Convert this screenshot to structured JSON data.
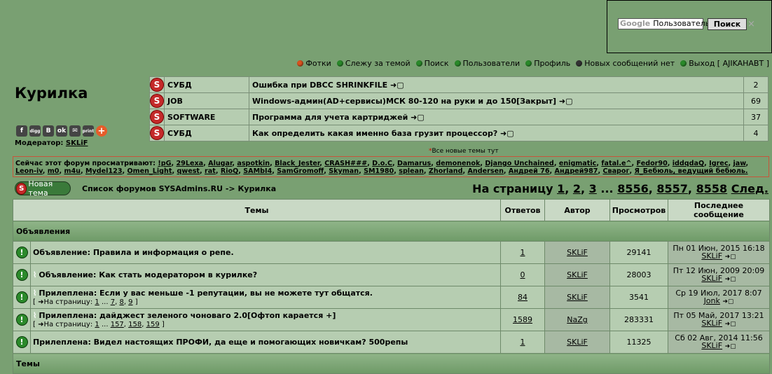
{
  "google": {
    "logo": "Google",
    "placeholder": "Пользователь",
    "button": "Поиск",
    "close": "×"
  },
  "nav": [
    {
      "label": "Фотки",
      "color": "#d9531f"
    },
    {
      "label": "Слежу за темой",
      "color": "#2a8a2a"
    },
    {
      "label": "Поиск",
      "color": "#2a8a2a"
    },
    {
      "label": "Пользователи",
      "color": "#2a8a2a"
    },
    {
      "label": "Профиль",
      "color": "#2a8a2a"
    },
    {
      "label": "Новых сообщений нет",
      "color": "#333333"
    },
    {
      "label": "Выход [ AJIKAHABT ]",
      "color": "#2a8a2a"
    }
  ],
  "forum_title": "Курилка",
  "share_icons": [
    "f",
    "digg",
    "B",
    "ok",
    "✉",
    "print",
    "+"
  ],
  "moderator": {
    "label": "Модератор:",
    "name": "SKLiF"
  },
  "hot_topics": [
    {
      "cat": "СУБД",
      "title": "Ошибка при DBCC SHRINKFILE ➜▢",
      "count": "2"
    },
    {
      "cat": "JOB",
      "title": "Windows-админ(AD+сервисы)МСК 80-120 на руки и до 150[Закрыт] ➜▢",
      "count": "69"
    },
    {
      "cat": "SOFTWARE",
      "title": "Программа для учета картриджей ➜▢",
      "count": "37"
    },
    {
      "cat": "СУБД",
      "title": "Как определить какая именно база грузит процессор? ➜▢",
      "count": "4"
    }
  ],
  "all_new": "Все новые темы тут",
  "viewers": {
    "label": "Сейчас этот форум просматривают:",
    "users": [
      "!pG",
      "29Lexa",
      "Alugar",
      "aspotkin",
      "Black_Jester",
      "CRASH###",
      "D.o.C",
      "Damarus",
      "demonenok",
      "Django Unchained",
      "enigmatic",
      "fatal.e^",
      "Fedor90",
      "iddqdaQ",
      "Igrec",
      "jaw",
      "Leon-iv",
      "m0",
      "m4u",
      "Mydel123",
      "Omen_Light",
      "qwest",
      "rat",
      "RioQ",
      "SAMbI4",
      "SamGromoff",
      "Skyman",
      "SM1980",
      "splean",
      "Zhorland",
      "Andersen",
      "Андрей 76",
      "Андрей987",
      "Сварог",
      "Я_Бебюль, ведущий бебюль."
    ]
  },
  "new_topic": "Новая тема",
  "breadcrumb": "Список форумов SYSAdmins.RU -> Курилка",
  "pager": {
    "label": "На страницу",
    "pages": [
      "1",
      "2",
      "3",
      "...",
      "8556",
      "8557",
      "8558"
    ],
    "next": "След."
  },
  "columns": {
    "topics": "Темы",
    "replies": "Ответов",
    "author": "Автор",
    "views": "Просмотров",
    "last": "Последнее сообщение"
  },
  "section1": "Объявления",
  "section2": "Темы",
  "topics": [
    {
      "clip": false,
      "title": "Объявление: Правила и информация о репе.",
      "pages": null,
      "replies": "1",
      "author": "SKLiF",
      "views": "29141",
      "last_date": "Пн 01 Июн, 2015 16:18",
      "last_user": "SKLiF"
    },
    {
      "clip": true,
      "title": "Объявление: Как стать модератором в курилке?",
      "pages": null,
      "replies": "0",
      "author": "SKLiF",
      "views": "28003",
      "last_date": "Пт 12 Июн, 2009 20:09",
      "last_user": "SKLiF"
    },
    {
      "clip": true,
      "title": "Прилеплена: Если у вас меньше -1 репутации, вы не можете тут общатся.",
      "pages": [
        "1",
        "...",
        "7",
        "8",
        "9"
      ],
      "replies": "84",
      "author": "SKLiF",
      "views": "3541",
      "last_date": "Ср 19 Июл, 2017 8:07",
      "last_user": "Jonk"
    },
    {
      "clip": true,
      "title": "Прилеплена: дайджест зеленого чоноваго 2.0[Офтоп карается +]",
      "pages": [
        "1",
        "...",
        "157",
        "158",
        "159"
      ],
      "replies": "1589",
      "author": "NaZg",
      "views": "283331",
      "last_date": "Пт 05 Май, 2017 13:21",
      "last_user": "SKLiF"
    },
    {
      "clip": false,
      "title": "Прилеплена: Видел настоящих ПРОФИ, да еще и помогающих новичкам? 500репы",
      "pages": null,
      "replies": "1",
      "author": "SKLiF",
      "views": "11325",
      "last_date": "Сб 02 Авг, 2014 11:56",
      "last_user": "SKLiF"
    }
  ],
  "pages_prefix": "[ ➜На страницу:",
  "pages_suffix": "]"
}
